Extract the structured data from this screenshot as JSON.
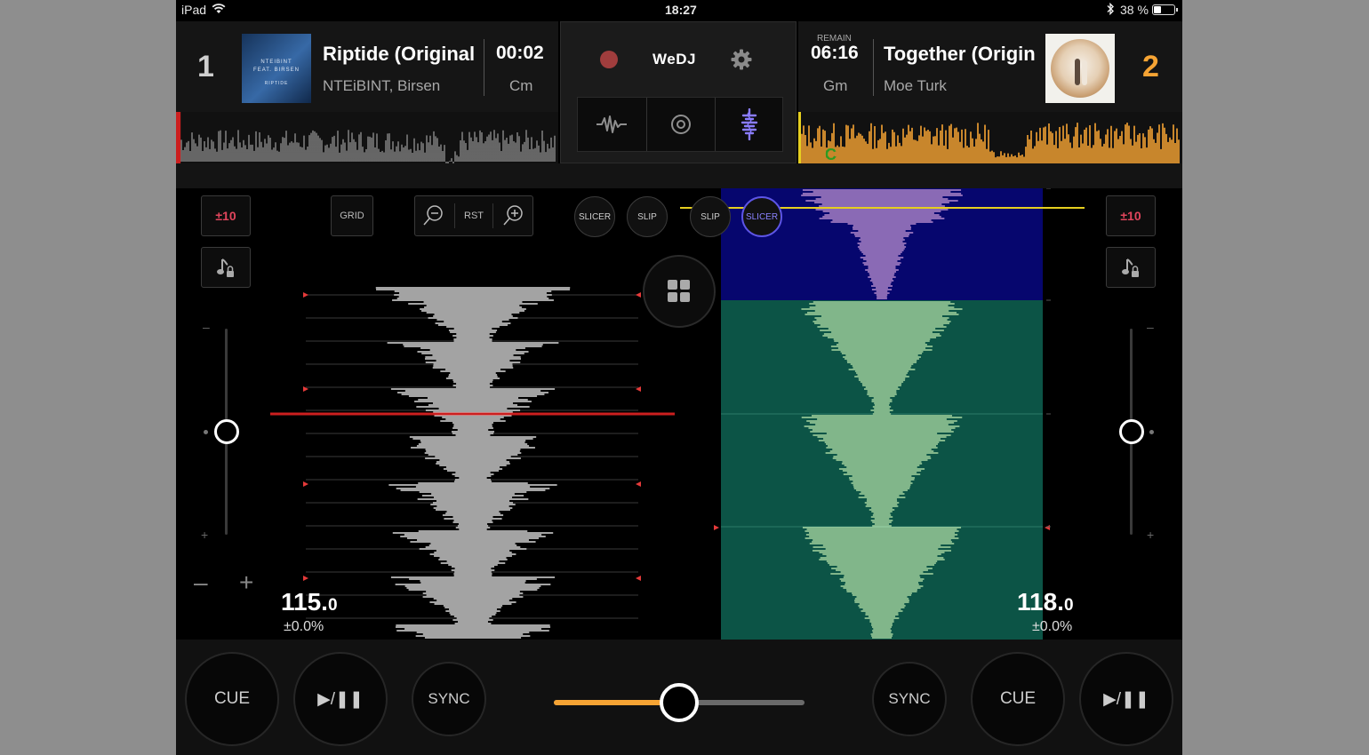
{
  "status_bar": {
    "device": "iPad",
    "time": "18:27",
    "battery": "38 %",
    "battery_level": 0.38
  },
  "deck1": {
    "number": "1",
    "title": "Riptide (Original",
    "artist": "NTEiBINT, Birsen",
    "time": "00:02",
    "key": "Cm",
    "artwork_lines": [
      "NTEIBINT",
      "FEAT. BIRSEN",
      "RIPTIDE"
    ],
    "bpm_main": "115.",
    "bpm_decimal": "0",
    "pitch": "±0.0%",
    "pitch_range": "±10",
    "grid_label": "GRID",
    "reset_label": "RST",
    "fx_buttons": [
      "SLICER",
      "SLIP"
    ],
    "play_position": 0.01,
    "color": "#d8d8d8"
  },
  "deck2": {
    "number": "2",
    "remain_label": "REMAIN",
    "time": "06:16",
    "title": "Together (Origin",
    "artist": "Moe Turk",
    "key": "Gm",
    "cue_marker": "C",
    "bpm_main": "118.",
    "bpm_decimal": "0",
    "pitch": "±0.0%",
    "pitch_range": "±10",
    "fx_buttons": [
      "SLIP",
      "SLICER"
    ],
    "active_fx": "SLICER",
    "play_position": 0.0,
    "color": "#f6a434"
  },
  "center": {
    "app_name": "WeDJ",
    "active_mode": "spectrum"
  },
  "transport": {
    "cue_label": "CUE",
    "play_pause_label": "▶/❚❚",
    "sync_label": "SYNC"
  },
  "crossfader": {
    "position": 0.5
  },
  "colors": {
    "deck2_accent": "#f6a434",
    "record": "#a03d3d",
    "slicer_active": "#5d55e6",
    "pitch_red": "#e0455c",
    "slicer_top": "#06066e",
    "slicer_bottom": "#0c5446",
    "playhead": "#cc1f1f",
    "beat_line": "#e6cf1f"
  }
}
